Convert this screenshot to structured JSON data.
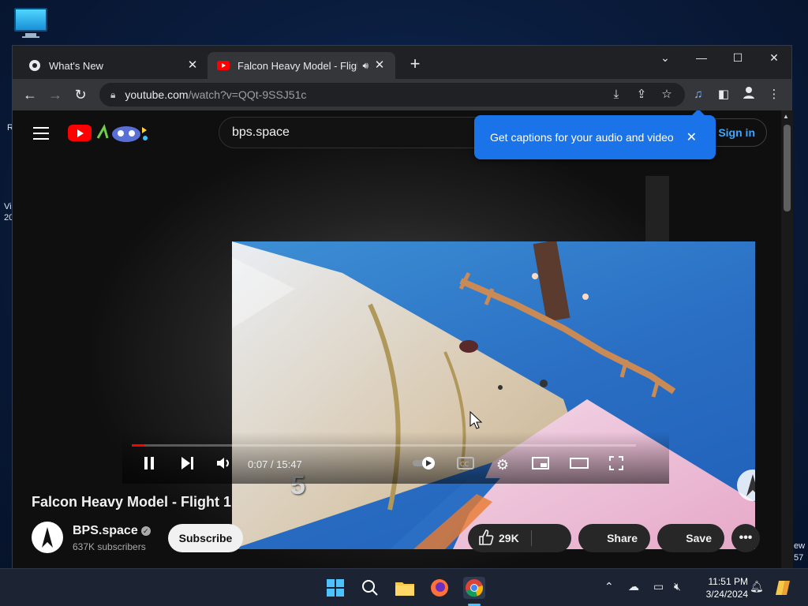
{
  "desktop": {
    "icon_name": "this-pc-icon",
    "fragment_left_1": "R",
    "fragment_left_2": "Vi",
    "fragment_left_3": "20",
    "fragment_right_1": "ew",
    "fragment_right_2": "57"
  },
  "browser": {
    "tabs": [
      {
        "title": "What's New",
        "active": false
      },
      {
        "title": "Falcon Heavy Model - Flight",
        "active": true
      }
    ],
    "url_host": "youtube.com",
    "url_path": "/watch?v=QQt-9SSJ51c"
  },
  "youtube": {
    "search_value": "bps.space",
    "sign_in": "Sign in",
    "caption_tip": "Get captions for your audio and video",
    "video": {
      "countdown": "5",
      "time": "0:07 / 15:47",
      "progress_fraction": 0.0074
    },
    "title": "Falcon Heavy Model - Flight 1",
    "channel": "BPS.space",
    "subscribers": "637K subscribers",
    "subscribe": "Subscribe",
    "likes": "29K",
    "share": "Share",
    "save": "Save"
  },
  "taskbar": {
    "time": "11:51 PM",
    "date": "3/24/2024"
  },
  "colors": {
    "accent_blue": "#1a73e8",
    "youtube_red": "#ff0000",
    "link_blue": "#3ea6ff"
  }
}
